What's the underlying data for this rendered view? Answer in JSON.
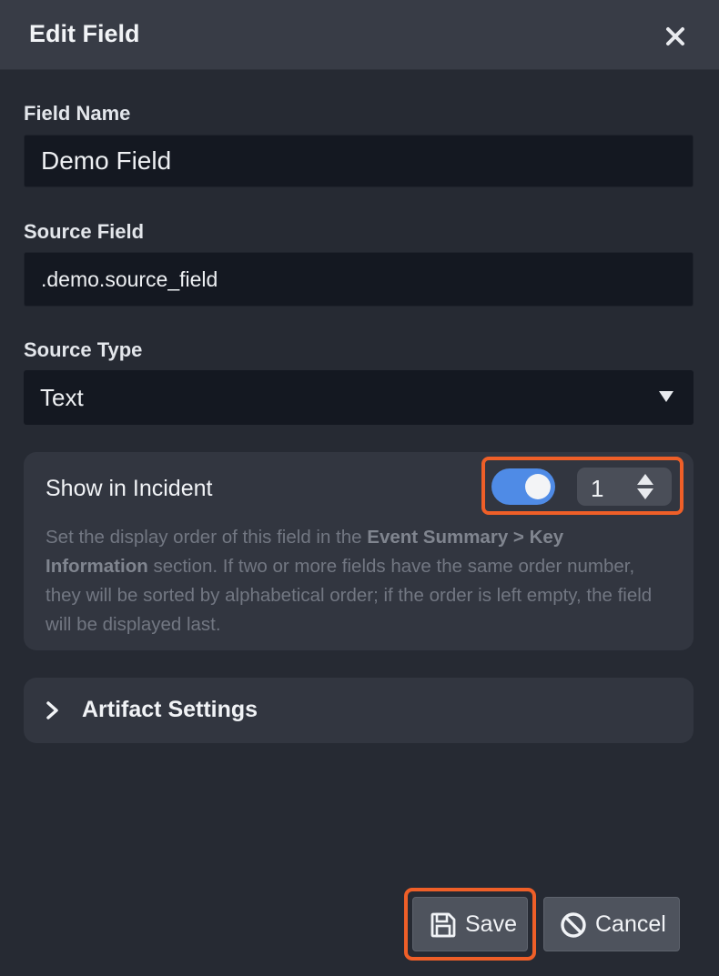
{
  "dialog": {
    "title": "Edit Field",
    "close_icon": "close-icon"
  },
  "form": {
    "field_name": {
      "label": "Field Name",
      "value": "Demo Field"
    },
    "source_field": {
      "label": "Source Field",
      "value": ".demo.source_field"
    },
    "source_type": {
      "label": "Source Type",
      "value": "Text",
      "icon": "caret-down-icon"
    }
  },
  "incident": {
    "title": "Show in Incident",
    "toggle_on": true,
    "order_value": "1",
    "description_1": "Set the display order of this field in the ",
    "description_bold": "Event Summary > Key Information",
    "description_2": " section. If two or more fields have the same order number, they will be sorted by alphabetical order; if the order is left empty, the field will be displayed last."
  },
  "artifact": {
    "label": "Artifact Settings",
    "icon": "chevron-right-icon"
  },
  "footer": {
    "save_label": "Save",
    "save_icon": "floppy-disk-icon",
    "cancel_label": "Cancel",
    "cancel_icon": "ban-icon"
  },
  "colors": {
    "background": "#262a33",
    "header": "#383c46",
    "input_bg": "#141821",
    "panel": "#323640",
    "toggle_accent": "#4f8be6",
    "highlight": "#ef5f28"
  }
}
